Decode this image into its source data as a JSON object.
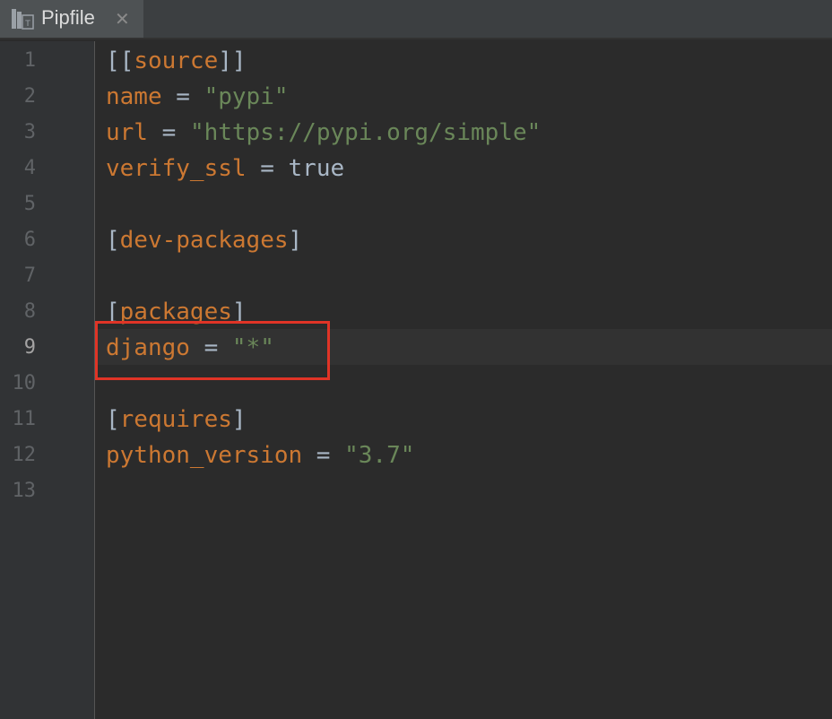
{
  "tab": {
    "title": "Pipfile",
    "icon": "pipfile-icon",
    "close_icon": "close-icon"
  },
  "gutter": {
    "line_numbers": [
      "1",
      "2",
      "3",
      "4",
      "5",
      "6",
      "7",
      "8",
      "9",
      "10",
      "11",
      "12",
      "13"
    ],
    "current_line": "9"
  },
  "code": {
    "l1": {
      "open": "[[",
      "name": "source",
      "close": "]]"
    },
    "l2": {
      "key": "name",
      "eq": " = ",
      "val": "\"pypi\""
    },
    "l3": {
      "key": "url",
      "eq": " = ",
      "val": "\"https://pypi.org/simple\""
    },
    "l4": {
      "key": "verify_ssl",
      "eq": " = ",
      "val": "true"
    },
    "l6": {
      "open": "[",
      "name": "dev-packages",
      "close": "]"
    },
    "l8": {
      "open": "[",
      "name": "packages",
      "close": "]"
    },
    "l9": {
      "key": "django",
      "eq": " = ",
      "val": "\"*\""
    },
    "l11": {
      "open": "[",
      "name": "requires",
      "close": "]"
    },
    "l12": {
      "key": "python_version",
      "eq": " = ",
      "val": "\"3.7\""
    }
  },
  "colors": {
    "keyword": "#cc7832",
    "string": "#6a8759",
    "plain": "#a9b7c6",
    "highlight_box": "#e03426"
  }
}
